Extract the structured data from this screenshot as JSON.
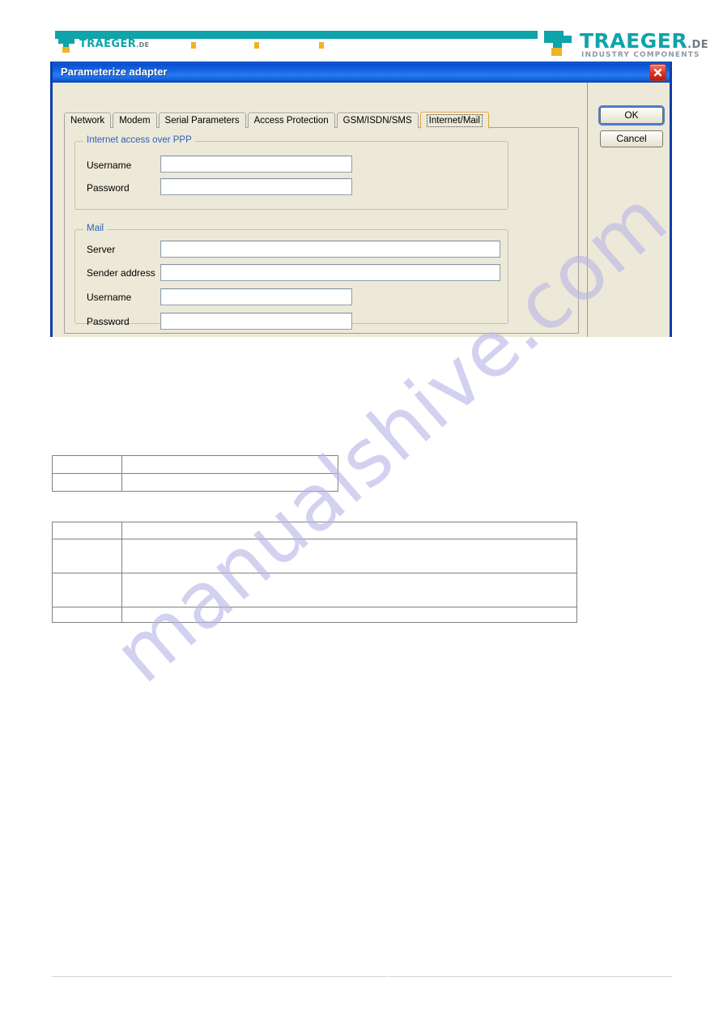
{
  "brand": {
    "left_logo": {
      "name": "TRAEGER",
      "suffix": ".DE"
    },
    "right_logo": {
      "name": "TRAEGER",
      "suffix": ".DE",
      "tagline": "INDUSTRY COMPONENTS"
    },
    "accent_teal": "#0fa3aa",
    "accent_orange": "#f0b323",
    "dots": [
      3
    ]
  },
  "dialog": {
    "title": "Parameterize adapter",
    "close_label": "Close",
    "titlebar_color": "#1565e8",
    "face_color": "#ece9d8",
    "tabs": [
      {
        "label": "Network",
        "active": false
      },
      {
        "label": "Modem",
        "active": false
      },
      {
        "label": "Serial Parameters",
        "active": false
      },
      {
        "label": "Access Protection",
        "active": false
      },
      {
        "label": "GSM/ISDN/SMS",
        "active": false
      },
      {
        "label": "Internet/Mail",
        "active": true
      }
    ],
    "groups": [
      {
        "title": "Internet access over PPP",
        "fields": [
          {
            "label": "Username",
            "value": "",
            "placeholder": ""
          },
          {
            "label": "Password",
            "value": "",
            "placeholder": ""
          }
        ]
      },
      {
        "title": "Mail",
        "fields": [
          {
            "label": "Server",
            "value": "",
            "placeholder": ""
          },
          {
            "label": "Sender address",
            "value": "",
            "placeholder": ""
          },
          {
            "label": "Username",
            "value": "",
            "placeholder": ""
          },
          {
            "label": "Password",
            "value": "",
            "placeholder": ""
          }
        ]
      }
    ],
    "buttons": [
      {
        "label": "OK",
        "default": true
      },
      {
        "label": "Cancel",
        "default": false
      }
    ]
  },
  "tables": {
    "table_one": {
      "rows": [
        [
          "",
          ""
        ],
        [
          "",
          ""
        ]
      ]
    },
    "table_two": {
      "rows": [
        [
          "",
          ""
        ],
        [
          "",
          ""
        ],
        [
          "",
          ""
        ],
        [
          "",
          ""
        ]
      ]
    }
  },
  "watermark": {
    "text": "manualshive.com",
    "color": "#b9b6e8"
  }
}
